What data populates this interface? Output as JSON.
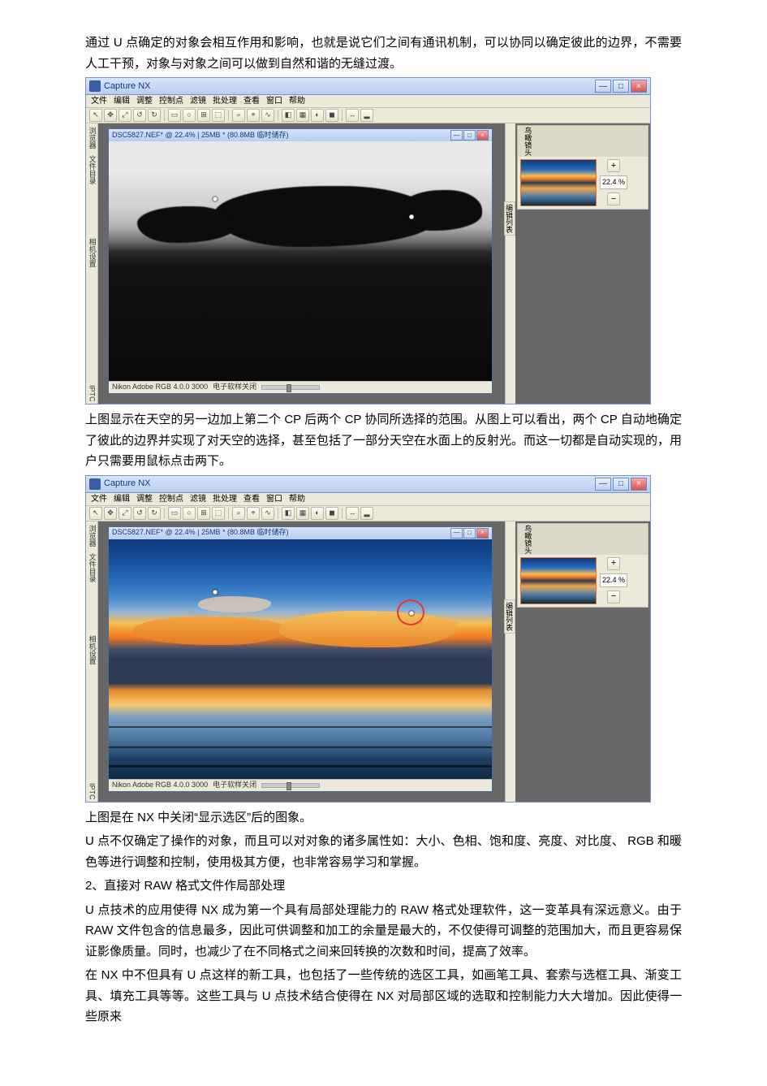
{
  "paragraphs": {
    "p1": "通过 U 点确定的对象会相互作用和影响，也就是说它们之间有通讯机制，可以协同以确定彼此的边界，不需要人工干预，对象与对象之间可以做到自然和谐的无缝过渡。",
    "p2": "上图显示在天空的另一边加上第二个 CP 后两个 CP 协同所选择的范围。从图上可以看出，两个 CP 自动地确定了彼此的边界并实现了对天空的选择，甚至包括了一部分天空在水面上的反射光。而这一切都是自动实现的，用户只需要用鼠标点击两下。",
    "p3": "上图是在 NX 中关闭“显示选区”后的图象。",
    "p4": "U 点不仅确定了操作的对象，而且可以对对象的诸多属性如：大小、色相、饱和度、亮度、对比度、 RGB 和暖色等进行调整和控制，使用极其方便，也非常容易学习和掌握。",
    "p5": "2、直接对 RAW 格式文件作局部处理",
    "p6": "U 点技术的应用使得 NX 成为第一个具有局部处理能力的 RAW 格式处理软件，这一变革具有深远意义。由于 RAW 文件包含的信息最多，因此可供调整和加工的余量是最大的，不仅使得可调整的范围加大，而且更容易保证影像质量。同时，也减少了在不同格式之间来回转换的次数和时间，提高了效率。",
    "p7": "在 NX 中不但具有 U 点这样的新工具，也包括了一些传统的选区工具，如画笔工具、套索与选框工具、渐变工具、填充工具等等。这些工具与 U 点技术结合使得在 NX 对局部区域的选取和控制能力大大增加。因此使得一些原来"
  },
  "app": {
    "title": "Capture NX",
    "doc_title": "DSC5827.NEF* @ 22.4% | 25MB * (80.8MB 临时储存)",
    "doc_title2": "DSC5827.NEF* @ 22.4% | 25MB * (80.8MB 临时储存)",
    "menus": [
      "文件",
      "编辑",
      "调整",
      "控制点",
      "滤镜",
      "批处理",
      "查看",
      "窗口",
      "帮助"
    ],
    "left_rail": [
      "浏览器",
      "文件目录"
    ],
    "left_rail_mid": [
      "相机设置"
    ],
    "left_rail_bot": "IPTC",
    "right_panel_header": "鸟瞰镜头",
    "right_editlist": "编辑列表",
    "zoom_value": "22.4 %",
    "status_colorspace": "Nikon Adobe RGB 4.0.0 3000",
    "status_soft": "电子软样关闭"
  },
  "winbtns": {
    "min": "—",
    "max": "□",
    "close": "×"
  },
  "tool_icons": [
    "↖",
    "✥",
    "⤢",
    "↺",
    "↻",
    "▭",
    "○",
    "⊞",
    "⬚",
    "⌕",
    "⌖",
    "∿",
    "◧",
    "▦",
    "◐",
    "◼",
    "↔",
    "▂"
  ]
}
